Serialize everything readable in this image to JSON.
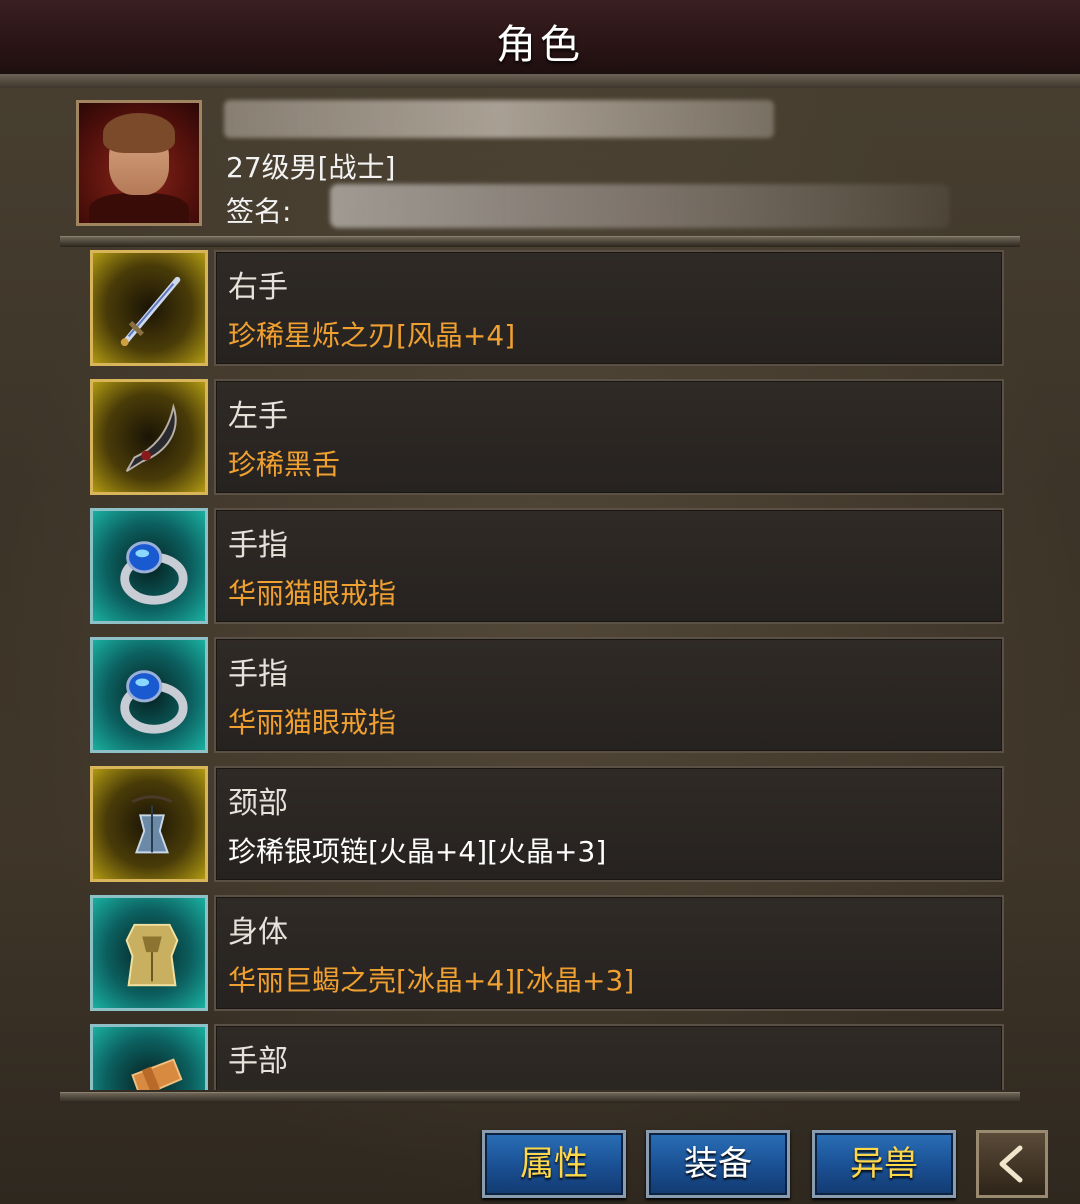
{
  "header": {
    "title": "角色"
  },
  "profile": {
    "level_text": "27级男[战士]",
    "signature_label": "签名:"
  },
  "equipment": [
    {
      "slot": "右手",
      "item": "珍稀星烁之刃[风晶+4]",
      "item_color": "#f0a030",
      "frame": "gold",
      "icon": "sword-icon"
    },
    {
      "slot": "左手",
      "item": "珍稀黑舌",
      "item_color": "#f0a030",
      "frame": "gold",
      "icon": "curved-blade-icon"
    },
    {
      "slot": "手指",
      "item": "华丽猫眼戒指",
      "item_color": "#f0a030",
      "frame": "teal",
      "icon": "ring-icon"
    },
    {
      "slot": "手指",
      "item": "华丽猫眼戒指",
      "item_color": "#f0a030",
      "frame": "teal",
      "icon": "ring-icon"
    },
    {
      "slot": "颈部",
      "item": "珍稀银项链[火晶+4][火晶+3]",
      "item_color": "#ffffff",
      "frame": "gold",
      "icon": "necklace-icon"
    },
    {
      "slot": "身体",
      "item": "华丽巨蝎之壳[冰晶+4][冰晶+3]",
      "item_color": "#f0a030",
      "frame": "teal",
      "icon": "armor-icon"
    },
    {
      "slot": "手部",
      "item": "",
      "item_color": "#f0a030",
      "frame": "teal",
      "icon": "gauntlet-icon"
    }
  ],
  "buttons": {
    "attributes": "属性",
    "equipment": "装备",
    "beasts": "异兽",
    "back_icon": "chevron-left-icon"
  }
}
